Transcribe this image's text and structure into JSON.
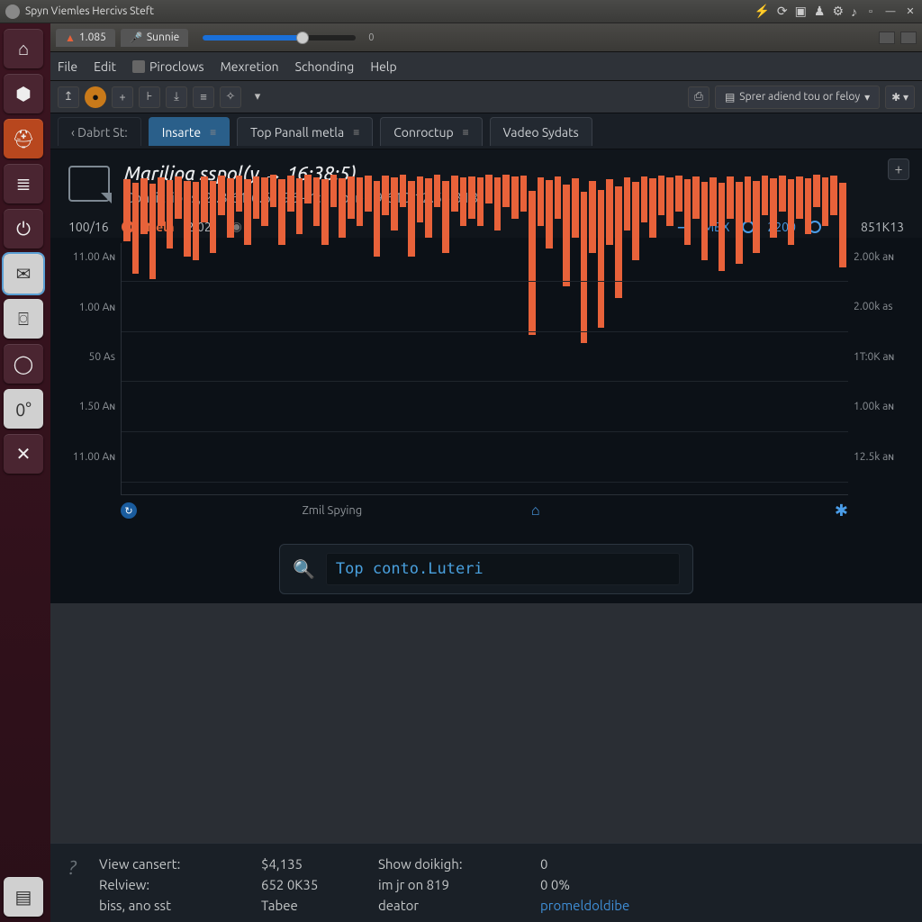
{
  "os": {
    "title": "Spyn Viemles Hercivs Steft",
    "tray_icons": [
      "bolt-icon",
      "sync-icon",
      "screen-icon",
      "user-icon",
      "gear-icon",
      "volume-icon",
      "divider",
      "minimize-icon",
      "close-icon"
    ]
  },
  "launcher": {
    "items": [
      {
        "name": "home-icon",
        "glyph": "⌂"
      },
      {
        "name": "folder-icon",
        "glyph": "⬢"
      },
      {
        "name": "help-icon",
        "glyph": "⛑"
      },
      {
        "name": "disk-icon",
        "glyph": "≣"
      },
      {
        "name": "power-icon",
        "glyph": "⏻"
      },
      {
        "name": "chat-icon",
        "glyph": "✉",
        "active": true,
        "light": true
      },
      {
        "name": "camera-icon",
        "glyph": "⌼",
        "light": true
      },
      {
        "name": "circle-icon",
        "glyph": "◯"
      },
      {
        "name": "zero-icon",
        "glyph": "0°",
        "light": true
      },
      {
        "name": "tools-icon",
        "glyph": "✕"
      }
    ],
    "bottom": {
      "name": "doc-icon",
      "glyph": "▤"
    }
  },
  "tabbar": {
    "tab1": "1.085",
    "tab2": "Sunnie",
    "slider_end": "0"
  },
  "menu": [
    "File",
    "Edit",
    "Piroclows",
    "Mexretion",
    "Schonding",
    "Help"
  ],
  "toolbar_right": {
    "camera": "⌼",
    "dropdown": "Sprer adiend tou or feloy",
    "gear": "✱"
  },
  "tabs": [
    {
      "label": "‹ Dabrt St:",
      "kind": "first"
    },
    {
      "label": "Insarte",
      "kind": "active",
      "close": "≡"
    },
    {
      "label": "Top Panall metla",
      "close": "≡"
    },
    {
      "label": "Conroctup",
      "close": "≡"
    },
    {
      "label": "Vadeo Sydats"
    }
  ],
  "header": {
    "title": "Marilioa sspol(y → 16:38:5)",
    "subtitle": "Confictions, 2:.3.61:6.61.96 - 1:15 þ. ▸ 19.610·12.56.318"
  },
  "legend": {
    "left_value": "100/16",
    "series_name": "Nelh",
    "series_time": "2:021",
    "right_label": "MBX",
    "right_value": "2200",
    "right_extra": "851K13"
  },
  "chart_data": {
    "type": "bar",
    "title": "",
    "xlabel": "Zmil Spying",
    "ylabel": "",
    "y_ticks_left": [
      "11.00 Aɴ",
      "1.00 Aɴ",
      "50 As",
      "1.50 Aɴ",
      "11.00 Aɴ"
    ],
    "y_ticks_right": [
      "2.00k aɴ",
      "2.00k as",
      "1T:0K aɴ",
      "1.00k aɴ",
      "12.5k aɴ"
    ],
    "ylim": [
      0,
      100
    ],
    "series": [
      {
        "name": "Nelh",
        "color": "#e8623a",
        "values": [
          38,
          55,
          34,
          58,
          30,
          42,
          26,
          46,
          48,
          28,
          44,
          24,
          36,
          22,
          40,
          26,
          30,
          20,
          40,
          22,
          34,
          18,
          30,
          40,
          20,
          36,
          26,
          30,
          22,
          46,
          24,
          32,
          20,
          46,
          28,
          36,
          20,
          44,
          22,
          30,
          26,
          30,
          18,
          32,
          20,
          26,
          22,
          88,
          30,
          42,
          26,
          62,
          36,
          92,
          44,
          84,
          40,
          68,
          32,
          48,
          28,
          36,
          24,
          30,
          22,
          40,
          26,
          48,
          30,
          54,
          26,
          50,
          28,
          44,
          24,
          36,
          22,
          40,
          26,
          34,
          20,
          30,
          24,
          52
        ]
      }
    ]
  },
  "search": {
    "value": "Top conto.Luteri"
  },
  "status": {
    "r1c1": "View cansert:",
    "r1c2": "$4,135",
    "r1c3": "Show doikigh:",
    "r1c4": "0",
    "r2c1": "Relview:",
    "r2c2": "652 0K35",
    "r2c3": "im jr on 819",
    "r2c4": "0 0%",
    "r3c1": "biss, ano sst",
    "r3c2": "Tabee",
    "r3c3": "deator",
    "r3c4": "promeldoldibe"
  }
}
